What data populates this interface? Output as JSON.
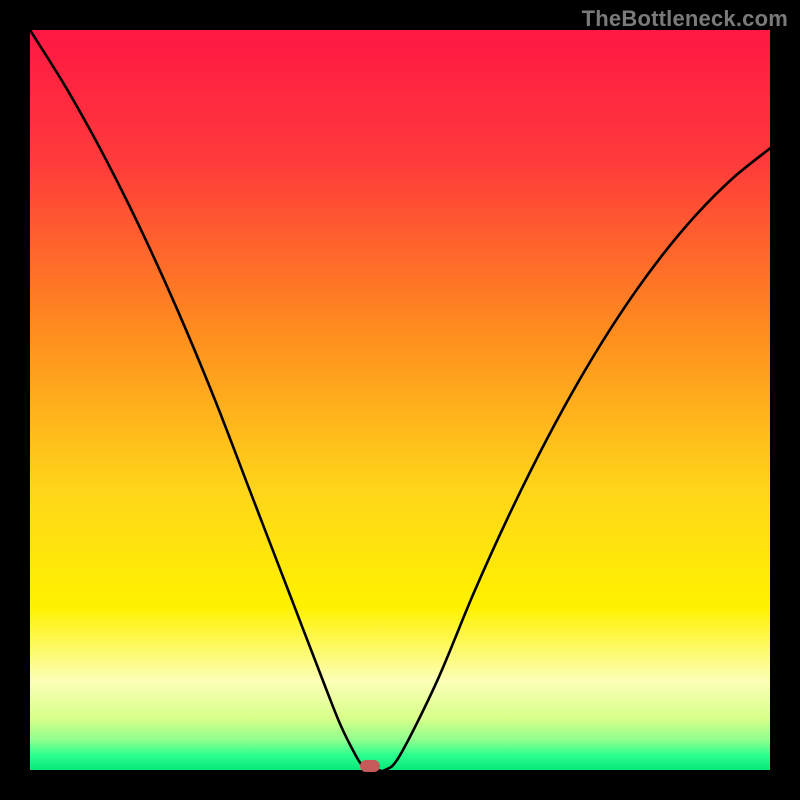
{
  "watermark": "TheBottleneck.com",
  "colors": {
    "frame_bg": "#000000",
    "gradient_stops": [
      {
        "pct": 0,
        "color": "#ff1744"
      },
      {
        "pct": 18,
        "color": "#ff3b3b"
      },
      {
        "pct": 40,
        "color": "#ff8a1f"
      },
      {
        "pct": 62,
        "color": "#ffd51a"
      },
      {
        "pct": 78,
        "color": "#fff200"
      },
      {
        "pct": 88,
        "color": "#fcffb8"
      },
      {
        "pct": 93,
        "color": "#d8ff8a"
      },
      {
        "pct": 96,
        "color": "#8eff8e"
      },
      {
        "pct": 98,
        "color": "#2bff90"
      },
      {
        "pct": 100,
        "color": "#08e87a"
      }
    ],
    "curve_stroke": "#000000",
    "marker_fill": "#c65a5a"
  },
  "chart_data": {
    "type": "line",
    "title": "",
    "xlabel": "",
    "ylabel": "",
    "xlim": [
      0,
      100
    ],
    "ylim": [
      0,
      100
    ],
    "series": [
      {
        "name": "bottleneck-curve",
        "x": [
          0,
          5,
          10,
          15,
          20,
          25,
          30,
          35,
          40,
          42,
          44,
          45,
          46,
          47,
          48,
          50,
          55,
          60,
          65,
          70,
          75,
          80,
          85,
          90,
          95,
          100
        ],
        "values": [
          100,
          92,
          83,
          73,
          62,
          50,
          37,
          24,
          11,
          6,
          2,
          0.5,
          0,
          0,
          0,
          2,
          12,
          24,
          35,
          45,
          54,
          62,
          69,
          75,
          80,
          84
        ]
      }
    ],
    "annotations": [
      {
        "name": "optimal-point",
        "x": 46,
        "y": 0.5
      }
    ],
    "grid": false,
    "legend": false
  }
}
